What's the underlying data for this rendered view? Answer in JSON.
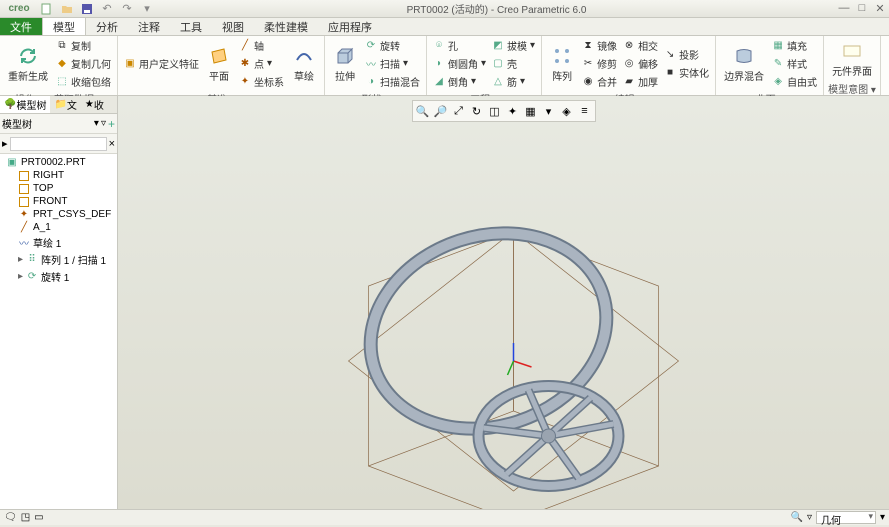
{
  "title": "PRT0002 (活动的) - Creo Parametric 6.0",
  "app_logo": "creo",
  "menu": {
    "file": "文件",
    "tabs": [
      "模型",
      "分析",
      "注释",
      "工具",
      "视图",
      "柔性建模",
      "应用程序"
    ],
    "active": 0
  },
  "ribbon": {
    "regen": "重新生成",
    "copy": "复制",
    "copy_geom": "复制几何",
    "shrink": "收缩包络",
    "op_label": "操作",
    "get_data": "获取数据",
    "udf": "用户定义特征",
    "plane": "平面",
    "axis": "轴",
    "csys": "坐标系",
    "point": "点",
    "sketch": "草绘",
    "datum_label": "基准",
    "extrude": "拉伸",
    "revolve": "旋转",
    "sweep": "扫描",
    "sweep_blend": "扫描混合",
    "shape_label": "形状",
    "hole": "孔",
    "round": "倒圆角",
    "chamfer": "倒角",
    "draft": "拔模",
    "shell": "壳",
    "rib": "筋",
    "eng_label": "工程",
    "pattern": "阵列",
    "mirror": "镜像",
    "trim": "修剪",
    "merge": "合并",
    "intersect": "相交",
    "offset": "偏移",
    "thicken": "加厚",
    "project": "投影",
    "solidify": "实体化",
    "edit_label": "编辑",
    "boundary": "边界混合",
    "style": "样式",
    "freeform": "自由式",
    "fill": "填充",
    "surf_label": "曲面",
    "comp_if": "元件界面",
    "intent_label": "模型意图"
  },
  "sidebar": {
    "tabs": [
      "模型树",
      "文",
      "收"
    ],
    "filter_label": "模型树",
    "search_placeholder": "",
    "tree": {
      "root": "PRT0002.PRT",
      "items": [
        "RIGHT",
        "TOP",
        "FRONT",
        "PRT_CSYS_DEF",
        "A_1",
        "草绘 1",
        "阵列 1 / 扫描 1",
        "旋转 1"
      ]
    }
  },
  "status": {
    "combo": "几何"
  }
}
